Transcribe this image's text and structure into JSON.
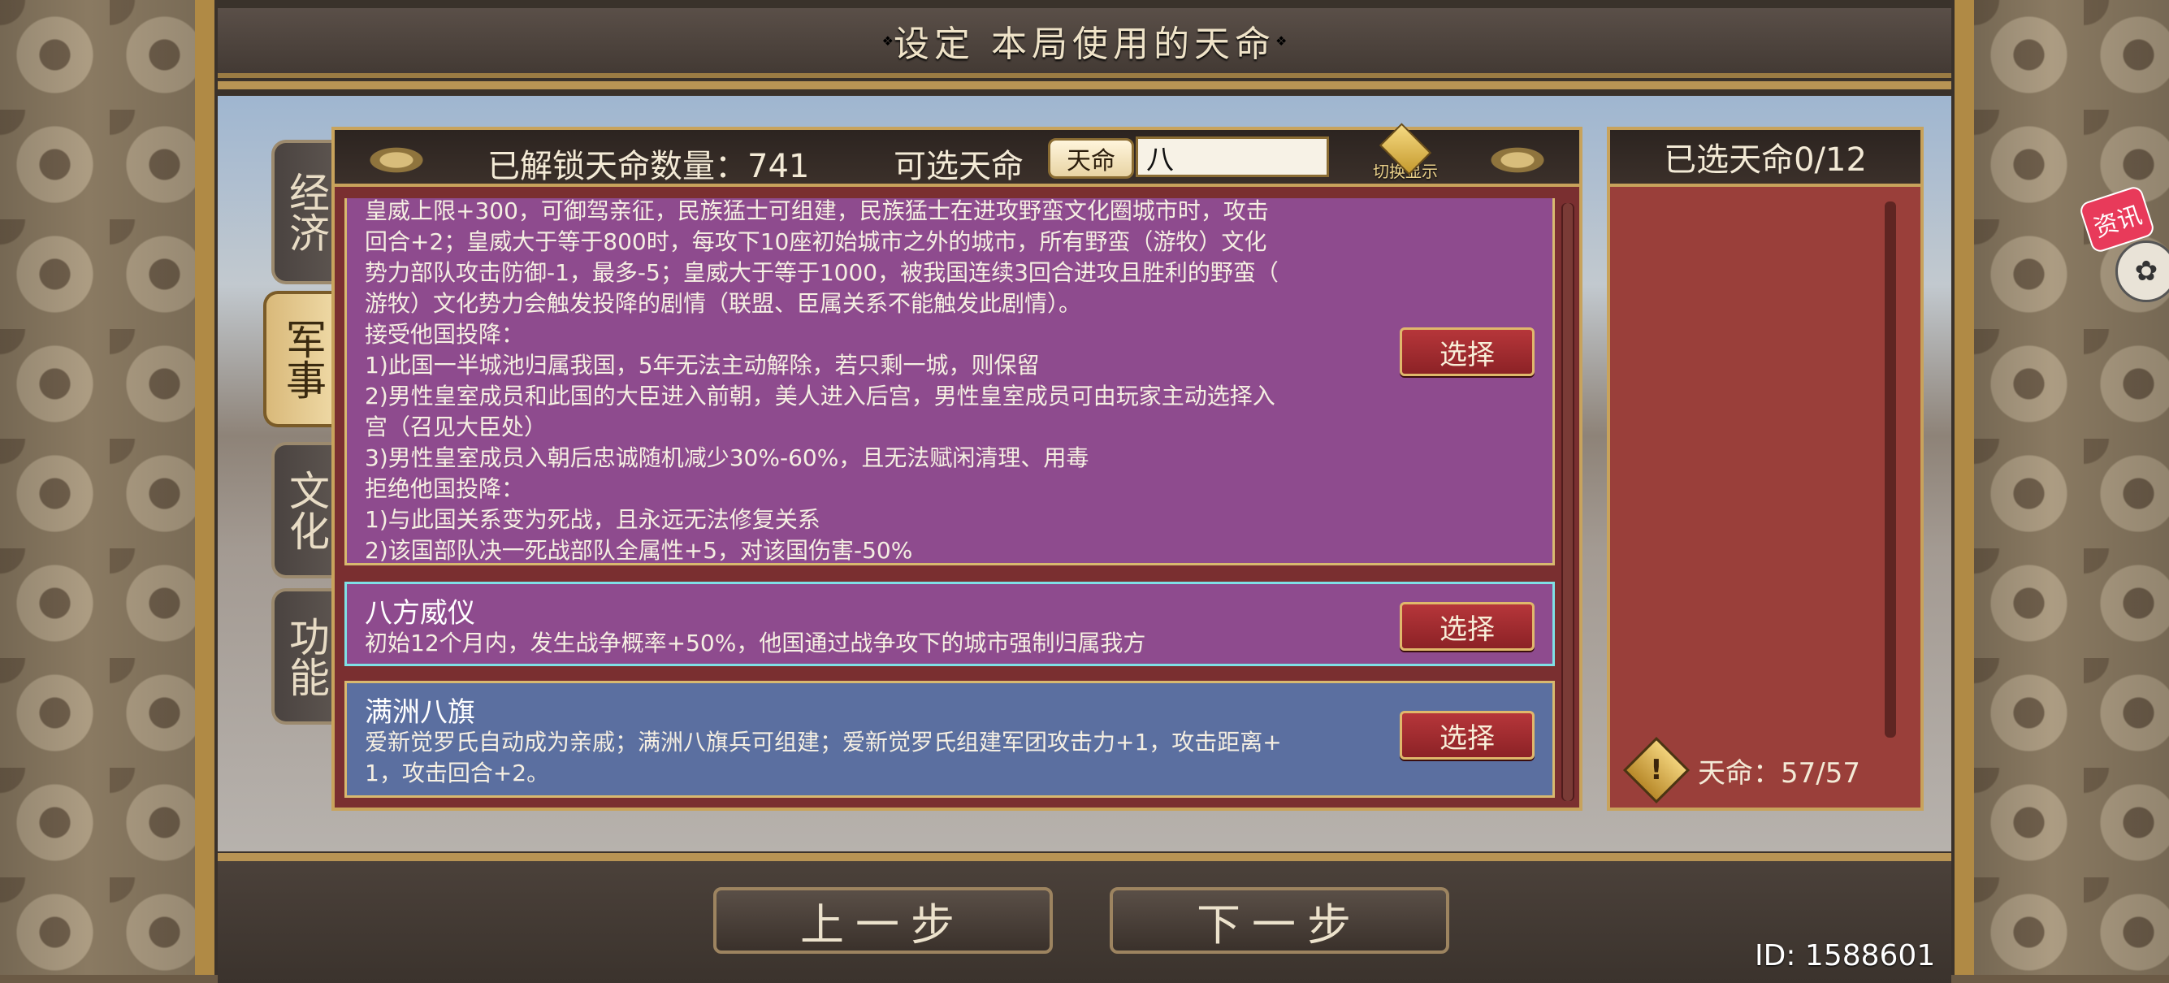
{
  "window": {
    "title": "设定 本局使用的天命",
    "id_label": "ID: 1588601"
  },
  "tabs": [
    {
      "label": "经济",
      "active": false
    },
    {
      "label": "军事",
      "active": true
    },
    {
      "label": "文化",
      "active": false
    },
    {
      "label": "功能",
      "active": false
    }
  ],
  "header": {
    "unlocked_label": "已解锁天命数量：741",
    "selectable_label": "可选天命",
    "search_tag": "天命",
    "search_value": "八",
    "switch_label": "切换显示"
  },
  "cards": [
    {
      "name": "",
      "desc": "皇威上限+300，可御驾亲征，民族猛士可组建，民族猛士在进攻野蛮文化圈城市时，攻击\n回合+2；皇威大于等于800时，每攻下10座初始城市之外的城市，所有野蛮（游牧）文化\n势力部队攻击防御-1，最多-5；皇威大于等于1000，被我国连续3回合进攻且胜利的野蛮（\n游牧）文化势力会触发投降的剧情（联盟、臣属关系不能触发此剧情）。\n接受他国投降：\n1)此国一半城池归属我国，5年无法主动解除，若只剩一城，则保留\n2)男性皇室成员和此国的大臣进入前朝，美人进入后宫，男性皇室成员可由玩家主动选择入\n宫（召见大臣处）\n3)男性皇室成员入朝后忠诚随机减少30%-60%，且无法赋闲清理、用毒\n拒绝他国投降：\n1)与此国关系变为死战，且永远无法修复关系\n2)该国部队决一死战部队全属性+5，对该国伤害-50%",
      "button": "选择"
    },
    {
      "name": "八方威仪",
      "desc": "初始12个月内，发生战争概率+50%，他国通过战争攻下的城市强制归属我方",
      "button": "选择"
    },
    {
      "name": "满洲八旗",
      "desc": "爱新觉罗氏自动成为亲戚；满洲八旗兵可组建；爱新觉罗氏组建军团攻击力+1，攻击距离+\n1，攻击回合+2。",
      "button": "选择"
    }
  ],
  "right_panel": {
    "title": "已选天命0/12",
    "footer": "天命：57/57"
  },
  "news": {
    "label": "资讯"
  },
  "nav": {
    "prev": "上一步",
    "next": "下一步"
  },
  "colors": {
    "card_purple": "#8e4b8e",
    "card_blue": "#5b6fa0",
    "panel_red": "#7a2f30",
    "gold_border": "#c8a35c",
    "button_red": "#b6363a"
  }
}
